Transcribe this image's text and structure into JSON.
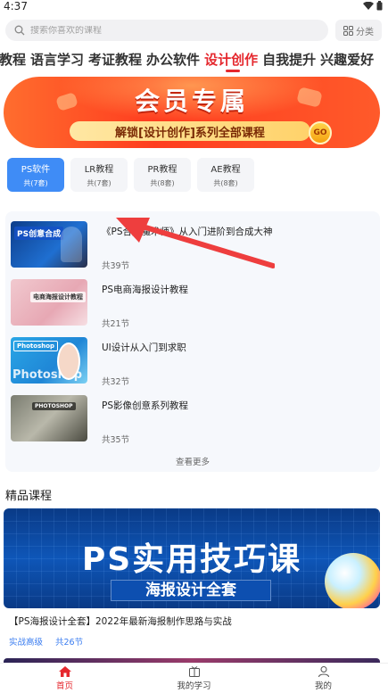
{
  "status_bar": {
    "time": "4:37"
  },
  "search": {
    "placeholder": "搜索你喜欢的课程",
    "category_label": "分类"
  },
  "top_tabs": [
    {
      "label": "程教程"
    },
    {
      "label": "语言学习"
    },
    {
      "label": "考证教程"
    },
    {
      "label": "办公软件"
    },
    {
      "label": "设计创作",
      "active": true
    },
    {
      "label": "自我提升"
    },
    {
      "label": "兴趣爱好"
    }
  ],
  "banner": {
    "title": "会员专属",
    "subtitle": "解锁[设计创作]系列全部课程",
    "go_label": "GO"
  },
  "sub_tabs": [
    {
      "name": "PS软件",
      "count": "共(7套)",
      "active": true
    },
    {
      "name": "LR教程",
      "count": "共(7套)"
    },
    {
      "name": "PR教程",
      "count": "共(8套)"
    },
    {
      "name": "AE教程",
      "count": "共(8套)"
    }
  ],
  "courses": [
    {
      "title": "《PS合成魔术师》从入门进阶到合成大神",
      "count": "共39节",
      "thumb_text": "PS创意合成"
    },
    {
      "title": "PS电商海报设计教程",
      "count": "共21节",
      "thumb_text": "电商海报设计教程"
    },
    {
      "title": "UI设计从入门到求职",
      "count": "共32节",
      "thumb_text": "Photoshop",
      "thumb_big": "Photoshop"
    },
    {
      "title": "PS影像创意系列教程",
      "count": "共35节",
      "thumb_text": "PHOTOSHOP"
    }
  ],
  "see_more": "查看更多",
  "premium": {
    "section_title": "精品课程",
    "banner_big": "PS实用技巧课",
    "banner_small": "海报设计全套",
    "course_title": "【PS海报设计全套】2022年最新海报制作思路与实战",
    "tags": [
      "实战高级",
      "共26节"
    ]
  },
  "bottom_nav": [
    {
      "label": "首页",
      "icon": "home-icon",
      "active": true
    },
    {
      "label": "我的学习",
      "icon": "book-icon"
    },
    {
      "label": "我的",
      "icon": "user-icon"
    }
  ],
  "colors": {
    "accent": "#e5282e",
    "tab_active_bg": "#3f8cf6",
    "link": "#3a7cf0"
  }
}
